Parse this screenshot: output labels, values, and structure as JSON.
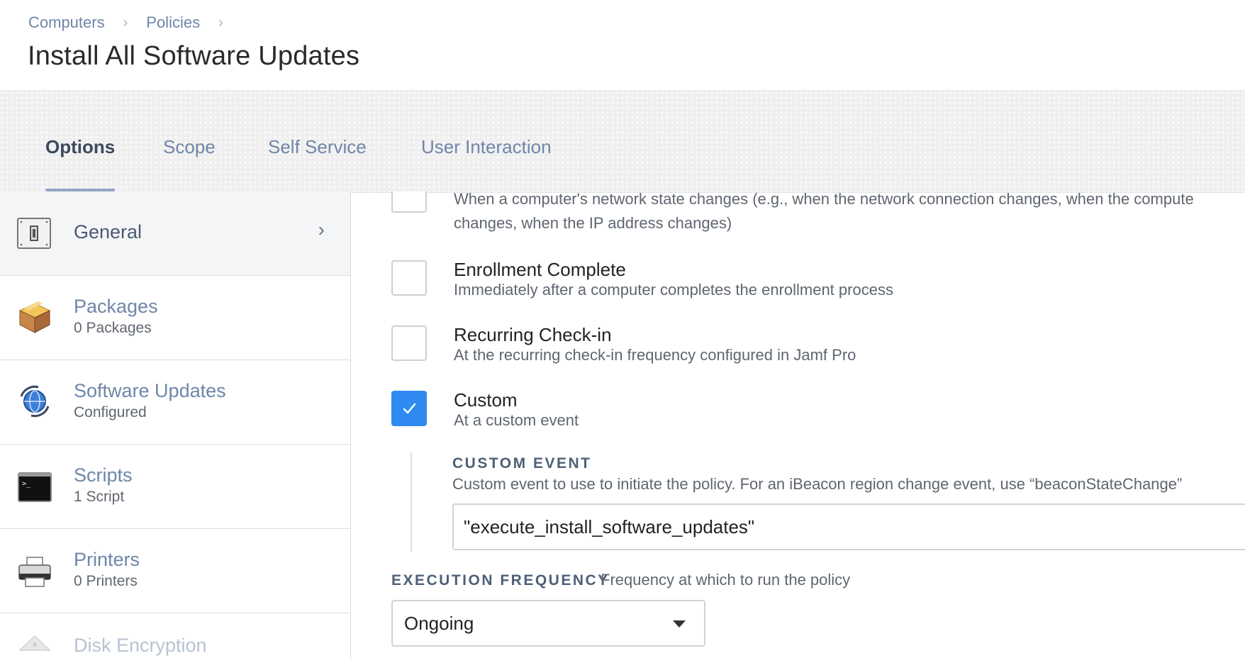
{
  "breadcrumb": {
    "items": [
      "Computers",
      "Policies"
    ]
  },
  "page_title": "Install All Software Updates",
  "tabs": [
    {
      "label": "Options",
      "active": true
    },
    {
      "label": "Scope"
    },
    {
      "label": "Self Service"
    },
    {
      "label": "User Interaction"
    }
  ],
  "sidebar": {
    "items": [
      {
        "title": "General",
        "subtitle": "",
        "icon": "general-switch-icon",
        "selected": true
      },
      {
        "title": "Packages",
        "subtitle": "0 Packages",
        "icon": "package-box-icon"
      },
      {
        "title": "Software Updates",
        "subtitle": "Configured",
        "icon": "software-update-globe-icon"
      },
      {
        "title": "Scripts",
        "subtitle": "1 Script",
        "icon": "terminal-icon"
      },
      {
        "title": "Printers",
        "subtitle": "0 Printers",
        "icon": "printer-icon"
      },
      {
        "title": "Disk Encryption",
        "subtitle": "",
        "icon": "disk-encryption-icon"
      }
    ]
  },
  "triggers": {
    "network_state": {
      "desc_line1": "When a computer's network state changes (e.g., when the network connection changes, when the compute",
      "desc_line2": "changes, when the IP address changes)",
      "checked": false
    },
    "enrollment": {
      "title": "Enrollment Complete",
      "desc": "Immediately after a computer completes the enrollment process",
      "checked": false
    },
    "recurring": {
      "title": "Recurring Check-in",
      "desc": "At the recurring check-in frequency configured in Jamf Pro",
      "checked": false
    },
    "custom": {
      "title": "Custom",
      "desc": "At a custom event",
      "checked": true
    }
  },
  "custom_event": {
    "label": "CUSTOM EVENT",
    "help": "Custom event to use to initiate the policy. For an iBeacon region change event, use “beaconStateChange”",
    "value": "\"execute_install_software_updates\""
  },
  "execution_frequency": {
    "label": "EXECUTION FREQUENCY",
    "help": "Frequency at which to run the policy",
    "selected": "Ongoing"
  },
  "colors": {
    "accent": "#2f8bf2",
    "link": "#6f86a8"
  }
}
